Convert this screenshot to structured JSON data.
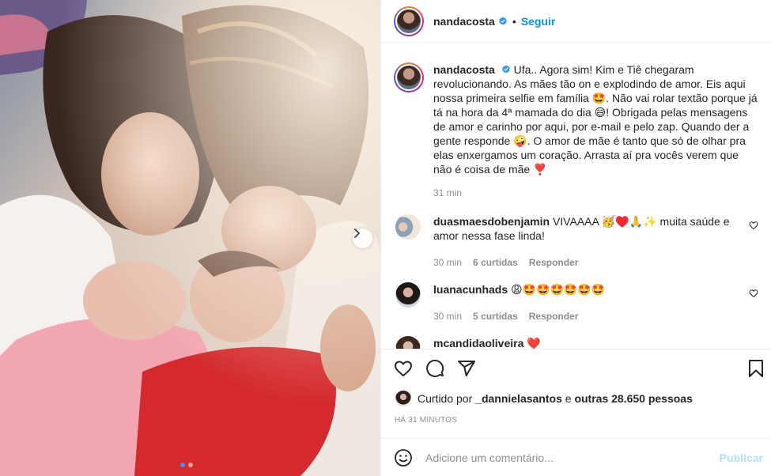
{
  "post": {
    "author": "nandacosta",
    "follow_label": "Seguir",
    "separator": "•"
  },
  "caption": {
    "author": "nandacosta",
    "text": "Ufa.. Agora sim! Kim e Tiê chegaram revolucionando. As mães tão on e explodindo de amor. Eis aqui nossa primeira selfie em família 🤩. Não vai rolar textão porque já tá na hora da 4ª mamada do dia 😅! Obrigada pelas mensagens de amor e carinho por aqui, por e-mail e pelo zap. Quando der a gente responde 🤪. O amor de mãe é tanto que só de olhar pra elas enxergamos um coração. Arrasta aí pra vocês verem que não é coisa de mãe ❣️",
    "time": "31 min"
  },
  "comments": [
    {
      "user": "duasmaesdobenjamin",
      "text": "VIVAAAA 🥳♥️🙏✨ muita saúde e amor nessa fase linda!",
      "time": "30 min",
      "likes": "6 curtidas",
      "reply": "Responder"
    },
    {
      "user": "luanacunhads",
      "text": "😩🤩🤩🤩🤩🤩🤩",
      "time": "30 min",
      "likes": "5 curtidas",
      "reply": "Responder"
    },
    {
      "user": "mcandidaoliveira",
      "text": "❤️"
    }
  ],
  "likes": {
    "prefix": "Curtido por",
    "user": "_dannielasantos",
    "middle": "e",
    "others": "outras 28.650 pessoas"
  },
  "date": "HÁ 31 MINUTOS",
  "composer": {
    "placeholder": "Adicione um comentário...",
    "publish_label": "Publicar"
  },
  "carousel": {
    "current": 1,
    "total": 2
  },
  "colors": {
    "link": "#0095f6",
    "verified": "#3897f0",
    "publish_disabled": "#b2dffc"
  },
  "icons": [
    "heart-icon",
    "comment-icon",
    "share-icon",
    "bookmark-icon",
    "emoji-icon",
    "verified-icon",
    "chevron-right-icon"
  ]
}
